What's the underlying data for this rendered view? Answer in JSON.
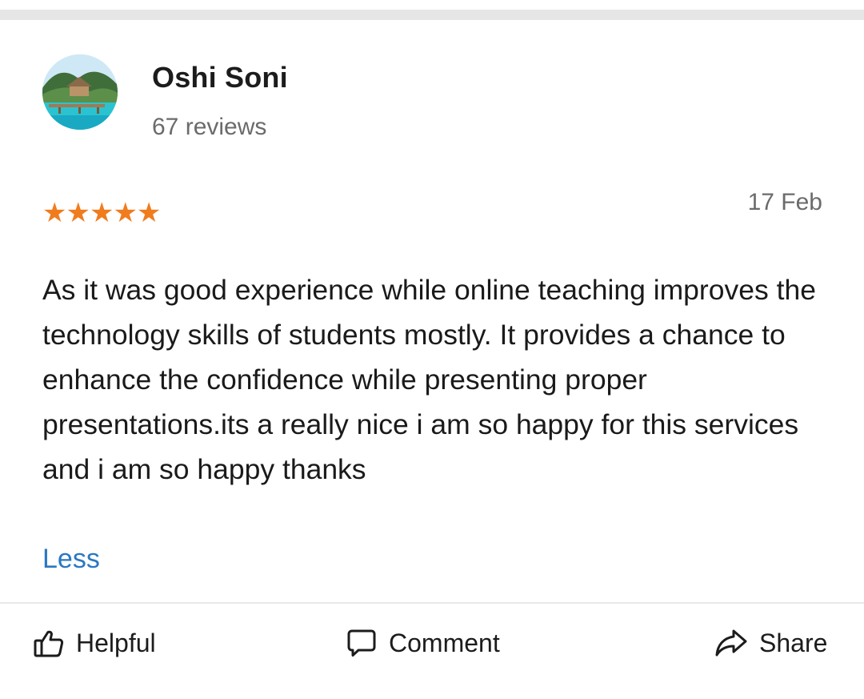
{
  "reviewer": {
    "name": "Oshi Soni",
    "review_count": "67 reviews"
  },
  "review": {
    "rating": 5,
    "stars": "★★★★★",
    "date": "17 Feb",
    "text": "As it was good experience while online teaching improves the technology skills of students mostly. It provides a chance to enhance the confidence while presenting proper presentations.its a really nice i am so happy for this services and i am so happy thanks",
    "toggle_label": "Less"
  },
  "actions": {
    "helpful_label": "Helpful",
    "comment_label": "Comment",
    "share_label": "Share"
  },
  "icons": {
    "helpful": "thumbs-up-icon",
    "comment": "comment-icon",
    "share": "share-icon"
  },
  "colors": {
    "star": "#f07c1e",
    "link": "#2a78c2",
    "secondary_text": "#6b6b6b"
  }
}
